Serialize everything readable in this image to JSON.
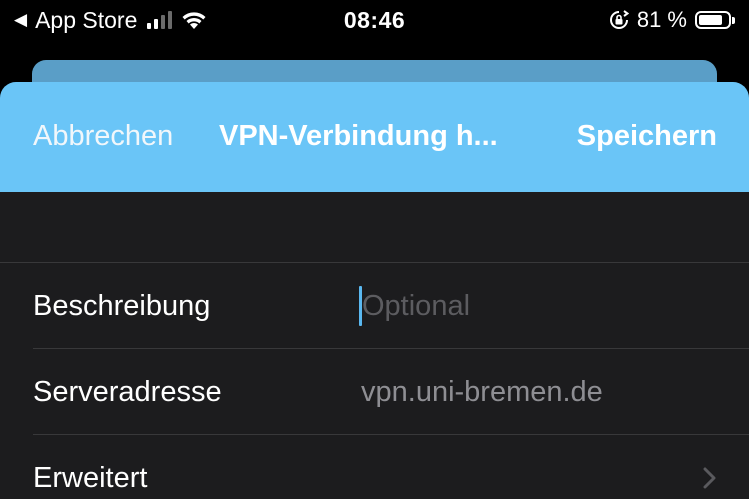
{
  "status_bar": {
    "back_app": "App Store",
    "time": "08:46",
    "battery_percent": "81 %",
    "battery_level": 0.81,
    "signal_bars_active": 2,
    "signal_bars_total": 4
  },
  "navbar": {
    "cancel_label": "Abbrechen",
    "title": "VPN-Verbindung h...",
    "save_label": "Speichern"
  },
  "form": {
    "rows": [
      {
        "label": "Beschreibung",
        "value": "",
        "placeholder": "Optional"
      },
      {
        "label": "Serveradresse",
        "value": "vpn.uni-bremen.de"
      },
      {
        "label": "Erweitert"
      }
    ]
  },
  "colors": {
    "nav_bg": "#6ac5f7",
    "sheet_bg": "#1c1c1e",
    "caret": "#5ab8f0"
  }
}
